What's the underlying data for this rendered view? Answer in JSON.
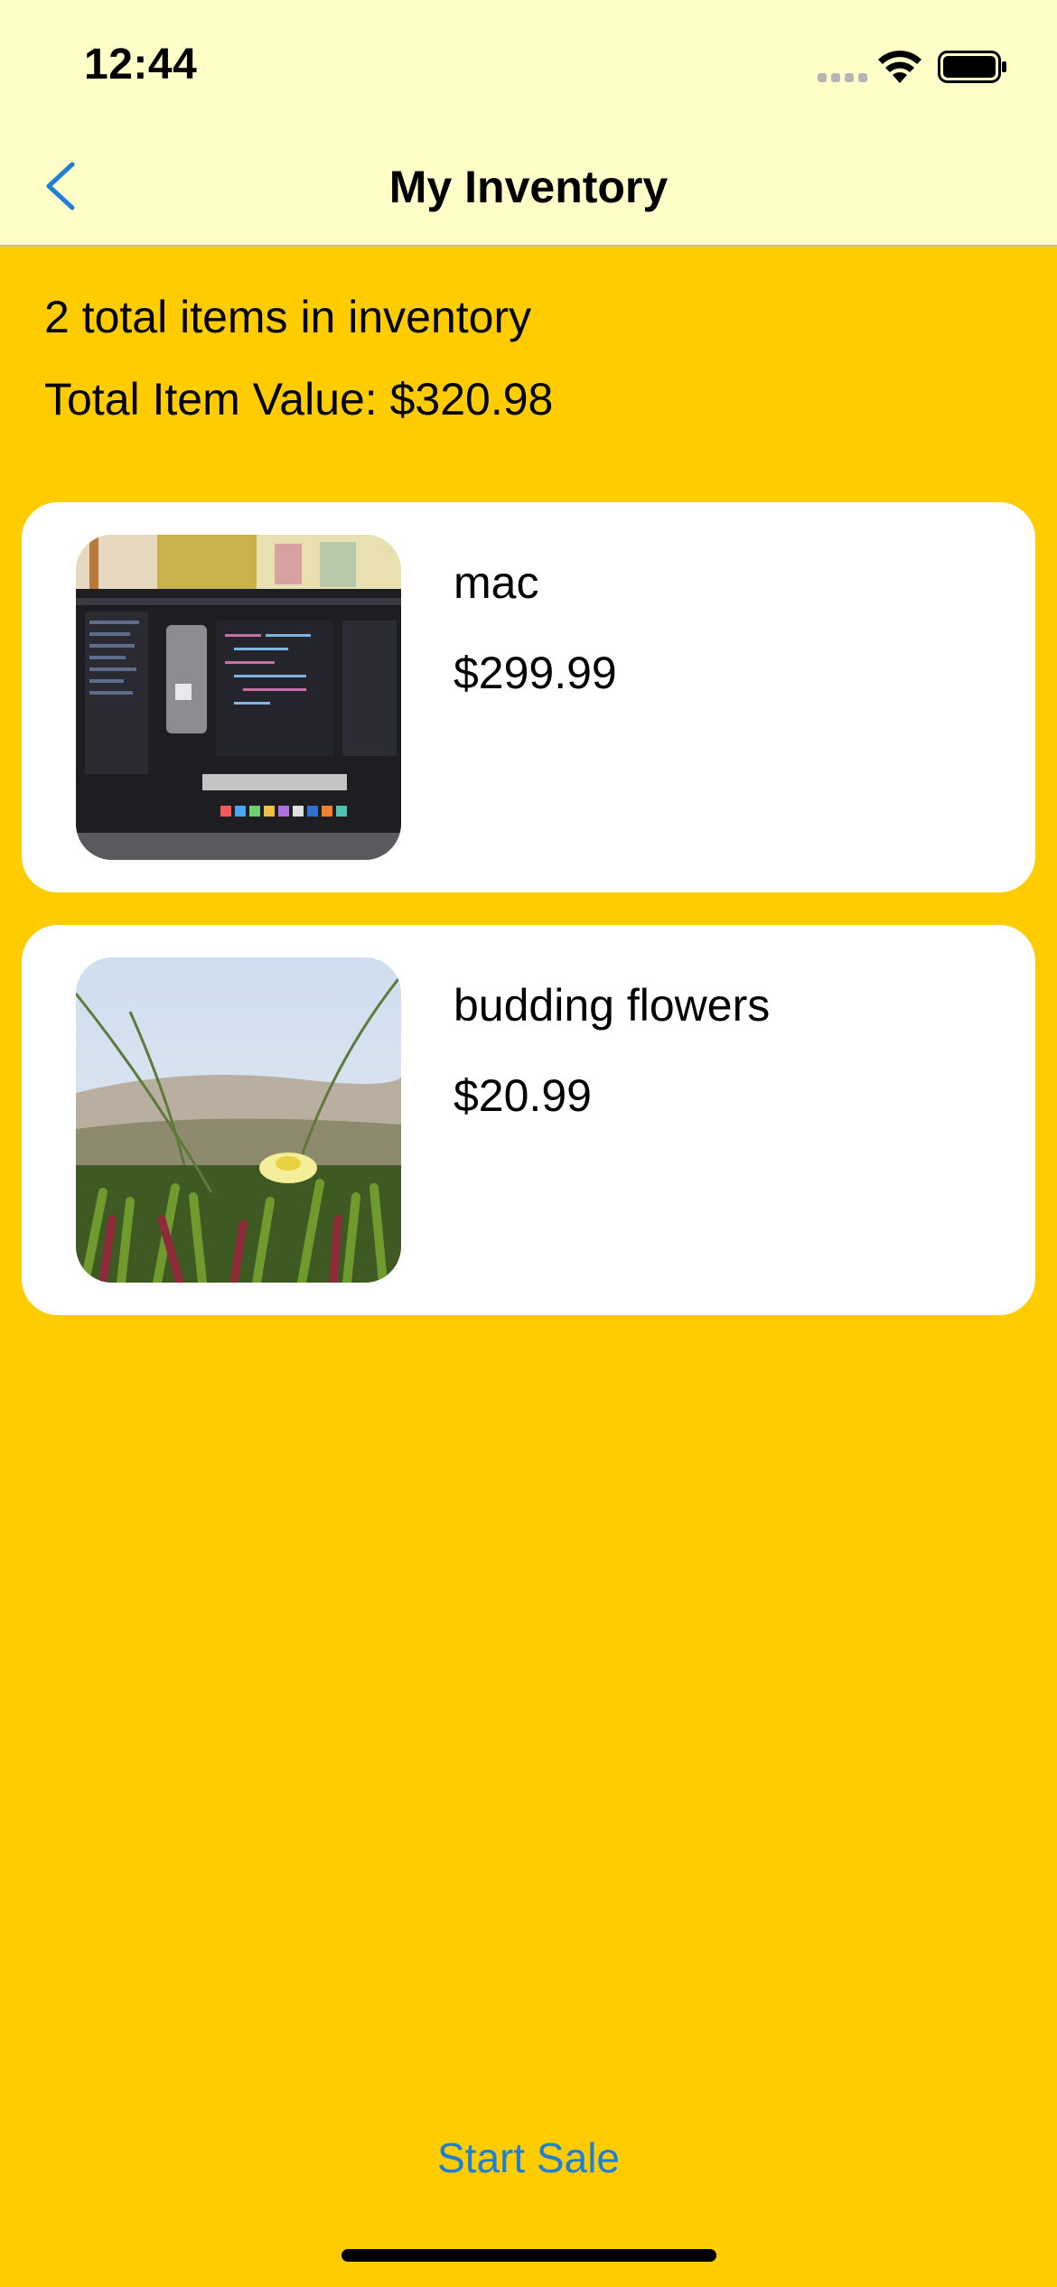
{
  "status_bar": {
    "time": "12:44"
  },
  "nav": {
    "title": "My Inventory",
    "back_icon": "chevron-left-icon"
  },
  "summary": {
    "count_text": "2 total items in inventory",
    "value_text": "Total Item Value: $320.98"
  },
  "items": [
    {
      "name": "mac",
      "price": "$299.99",
      "thumbnail": "laptop-photo"
    },
    {
      "name": "budding flowers",
      "price": "$20.99",
      "thumbnail": "flower-photo"
    }
  ],
  "actions": {
    "start_sale_label": "Start Sale"
  },
  "colors": {
    "background": "#FFCC00",
    "header": "#FFFDC8",
    "accent": "#1E7FD6",
    "card": "#FFFFFF"
  }
}
